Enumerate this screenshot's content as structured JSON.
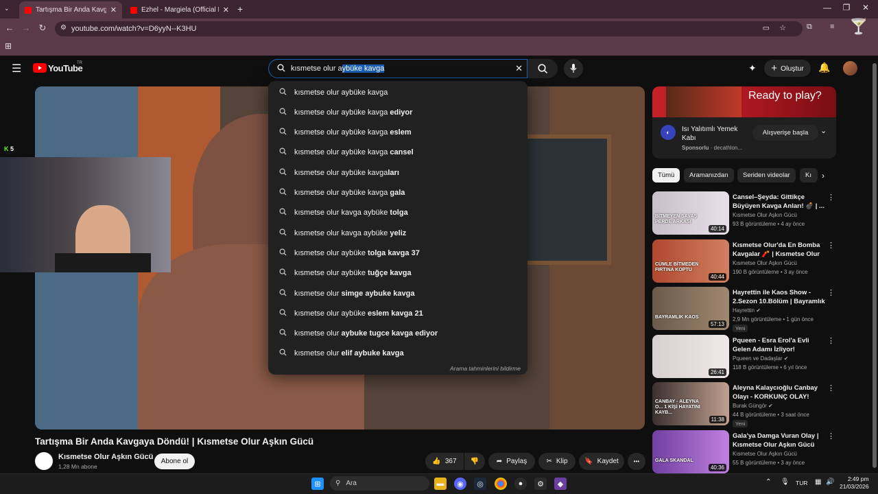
{
  "browser": {
    "tabs": [
      {
        "title": "Tartışma Bir Anda Kavgaya Döndü!",
        "active": true
      },
      {
        "title": "Ezhel - Margiela (Official Music",
        "active": false
      }
    ],
    "url": "youtube.com/watch?v=D6yyN--K3HU",
    "new_tab": "+",
    "tab_close": "✕",
    "win_minimize": "—",
    "win_restore": "❐",
    "win_close": "✕"
  },
  "youtube": {
    "logo_text": "YouTube",
    "country": "TR",
    "search": {
      "query_prefix": "kısmetse olur a",
      "query_selected": "ybüke kavga",
      "clear": "✕"
    },
    "create_label": "Oluştur",
    "suggestions": [
      {
        "base": "kısmetse olur aybüke kavga",
        "bold": ""
      },
      {
        "base": "kısmetse olur aybüke kavga",
        "bold": " ediyor"
      },
      {
        "base": "kısmetse olur aybüke kavga",
        "bold": " eslem"
      },
      {
        "base": "kısmetse olur aybüke kavga",
        "bold": " cansel"
      },
      {
        "base": "kısmetse olur aybüke kavga",
        "bold": "ları"
      },
      {
        "base": "kısmetse olur aybüke kavga",
        "bold": " gala"
      },
      {
        "base": "kısmetse olur kavga aybüke",
        "bold": " tolga"
      },
      {
        "base": "kısmetse olur kavga aybüke",
        "bold": " yeliz"
      },
      {
        "base": "kısmetse olur aybüke",
        "bold": " tolga kavga 37"
      },
      {
        "base": "kısmetse olur aybüke",
        "bold": " tuğçe kavga"
      },
      {
        "base": "kısmetse olur",
        "bold": " simge aybuke kavga"
      },
      {
        "base": "kısmetse olur aybüke",
        "bold": " eslem kavga 21"
      },
      {
        "base": "kısmetse olur",
        "bold": " aybuke tugce kavga ediyor"
      },
      {
        "base": "kısmetse olur",
        "bold": " elif aybuke kavga"
      }
    ],
    "report_link": "Arama tahminlerini bildirme",
    "kick_badge": "5",
    "video": {
      "title": "Tartışma Bir Anda Kavgaya Döndü! | Kısmetse Olur Aşkın Gücü",
      "channel": "Kısmetse Olur Aşkın Gücü",
      "subscribers": "1,28 Mn abone",
      "subscribe": "Abone ol",
      "likes": "367",
      "share": "Paylaş",
      "clip": "Klip",
      "save": "Kaydet",
      "more": "•••"
    },
    "ad": {
      "banner": "Ready to play?",
      "title": "Isı Yalıtımlı Yemek Kabı",
      "sponsor": "Sponsorlu",
      "advertiser": "decathlon...",
      "cta": "Alışverişe başla"
    },
    "chips": [
      "Tümü",
      "Aramanızdan",
      "Seriden videolar",
      "Kı"
    ],
    "recommendations": [
      {
        "title": "Cansel–Şeyda: Gittikçe Büyüyen Kavga Anları! 💣 | ...",
        "channel": "Kısmetse Olur Aşkın Gücü",
        "meta": "93 B görüntüleme • 4 ay önce",
        "duration": "40:14",
        "overlay": "BİTMEYEN SAVAŞ PERDE ARKASI",
        "new": ""
      },
      {
        "title": "Kısmetse Olur'da En Bomba Kavgalar 🧨 | Kısmetse Olur ...",
        "channel": "Kısmetse Olur Aşkın Gücü",
        "meta": "190 B görüntüleme • 3 ay önce",
        "duration": "40:44",
        "overlay": "CÜMLE BİTMEDEN FIRTINA KOPTU",
        "new": ""
      },
      {
        "title": "Hayrettin ile Kaos Show - 2.Sezon 10.Bölüm | Bayramlık ...",
        "channel": "Hayrettin ✔",
        "meta": "2,9 Mn görüntüleme • 1 gün önce",
        "duration": "57:13",
        "overlay": "BAYRAMLIK KAOS",
        "new": "Yeni"
      },
      {
        "title": "Pqueen - Esra Erol'a Evli Gelen Adamı İzliyor!",
        "channel": "Pqueen ve Dadaşlar ✔",
        "meta": "118 B görüntüleme • 6 yıl önce",
        "duration": "26:41",
        "overlay": "",
        "new": ""
      },
      {
        "title": "Aleyna Kalaycıoğlu Canbay Olayı - KORKUNÇ OLAY!",
        "channel": "Burak Güngör ✔",
        "meta": "44 B görüntüleme • 3 saat önce",
        "duration": "11:38",
        "overlay": "CANBAY - ALEYNA O... 1 KİŞİ HAYATINI KAYB...",
        "new": "Yeni"
      },
      {
        "title": "Gala'ya Damga Vuran Olay | Kısmetse Olur Aşkın Gücü",
        "channel": "Kısmetse Olur Aşkın Gücü",
        "meta": "55 B görüntüleme • 3 ay önce",
        "duration": "40:36",
        "overlay": "GALA SKANDAL",
        "new": ""
      }
    ]
  },
  "taskbar": {
    "search": "Ara",
    "lang": "TUR",
    "time": "2:49 pm",
    "date": "21/03/2026"
  },
  "colors": {
    "accent": "#1c62b9",
    "brand": "#ff0000",
    "chrome": "#5a3a46"
  }
}
